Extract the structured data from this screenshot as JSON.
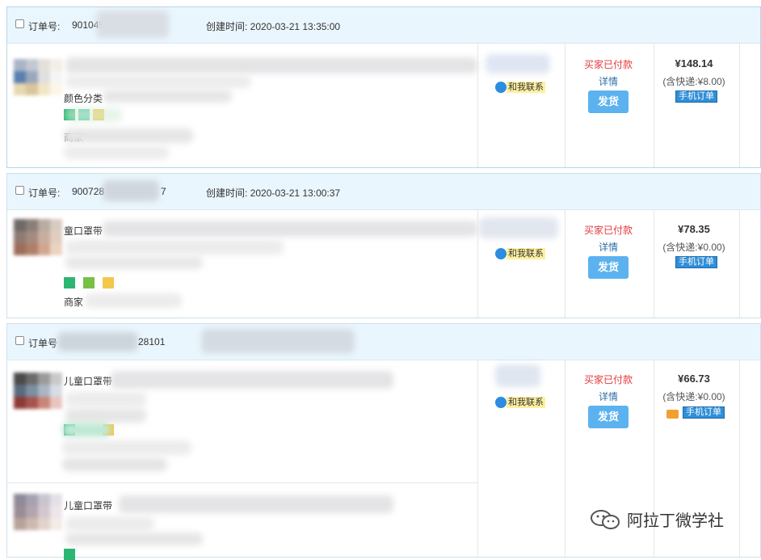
{
  "orders": [
    {
      "order_label": "订单号:",
      "order_no_visible": "90104556",
      "created": "创建时间: 2020-03-21 13:35:00",
      "product_line": "颜色分类",
      "store_label": "商家",
      "status": "买家已付款",
      "detail": "详情",
      "ship_button": "发货",
      "price": "¥148.14",
      "shipping": "(含快递:¥8.00)",
      "mobile_tag": "手机订单",
      "contact": "和我联系"
    },
    {
      "order_label": "订单号:",
      "order_no_visible": "900728",
      "order_no_tail": "7",
      "created": "创建时间: 2020-03-21 13:00:37",
      "product_line": "童口罩带",
      "store_label": "商家",
      "status": "买家已付款",
      "detail": "详情",
      "ship_button": "发货",
      "price": "¥78.35",
      "shipping": "(含快递:¥0.00)",
      "mobile_tag": "手机订单",
      "contact": "和我联系"
    },
    {
      "order_label": "订单号",
      "order_no_tail": "28101",
      "product_line": "儿童口罩带",
      "product_line_2": "儿童口罩带",
      "status": "买家已付款",
      "detail": "详情",
      "ship_button": "发货",
      "price": "¥66.73",
      "shipping": "(含快递:¥0.00)",
      "mobile_tag": "手机订单",
      "contact": "和我联系"
    }
  ],
  "watermark": "阿拉丁微学社",
  "colors": {
    "header_bg": "#eaf6fd",
    "status_red": "#e4393c",
    "link_blue": "#2d6fa6",
    "button_blue": "#5bb2ef",
    "mobile_tag": "#2f8fd8"
  }
}
